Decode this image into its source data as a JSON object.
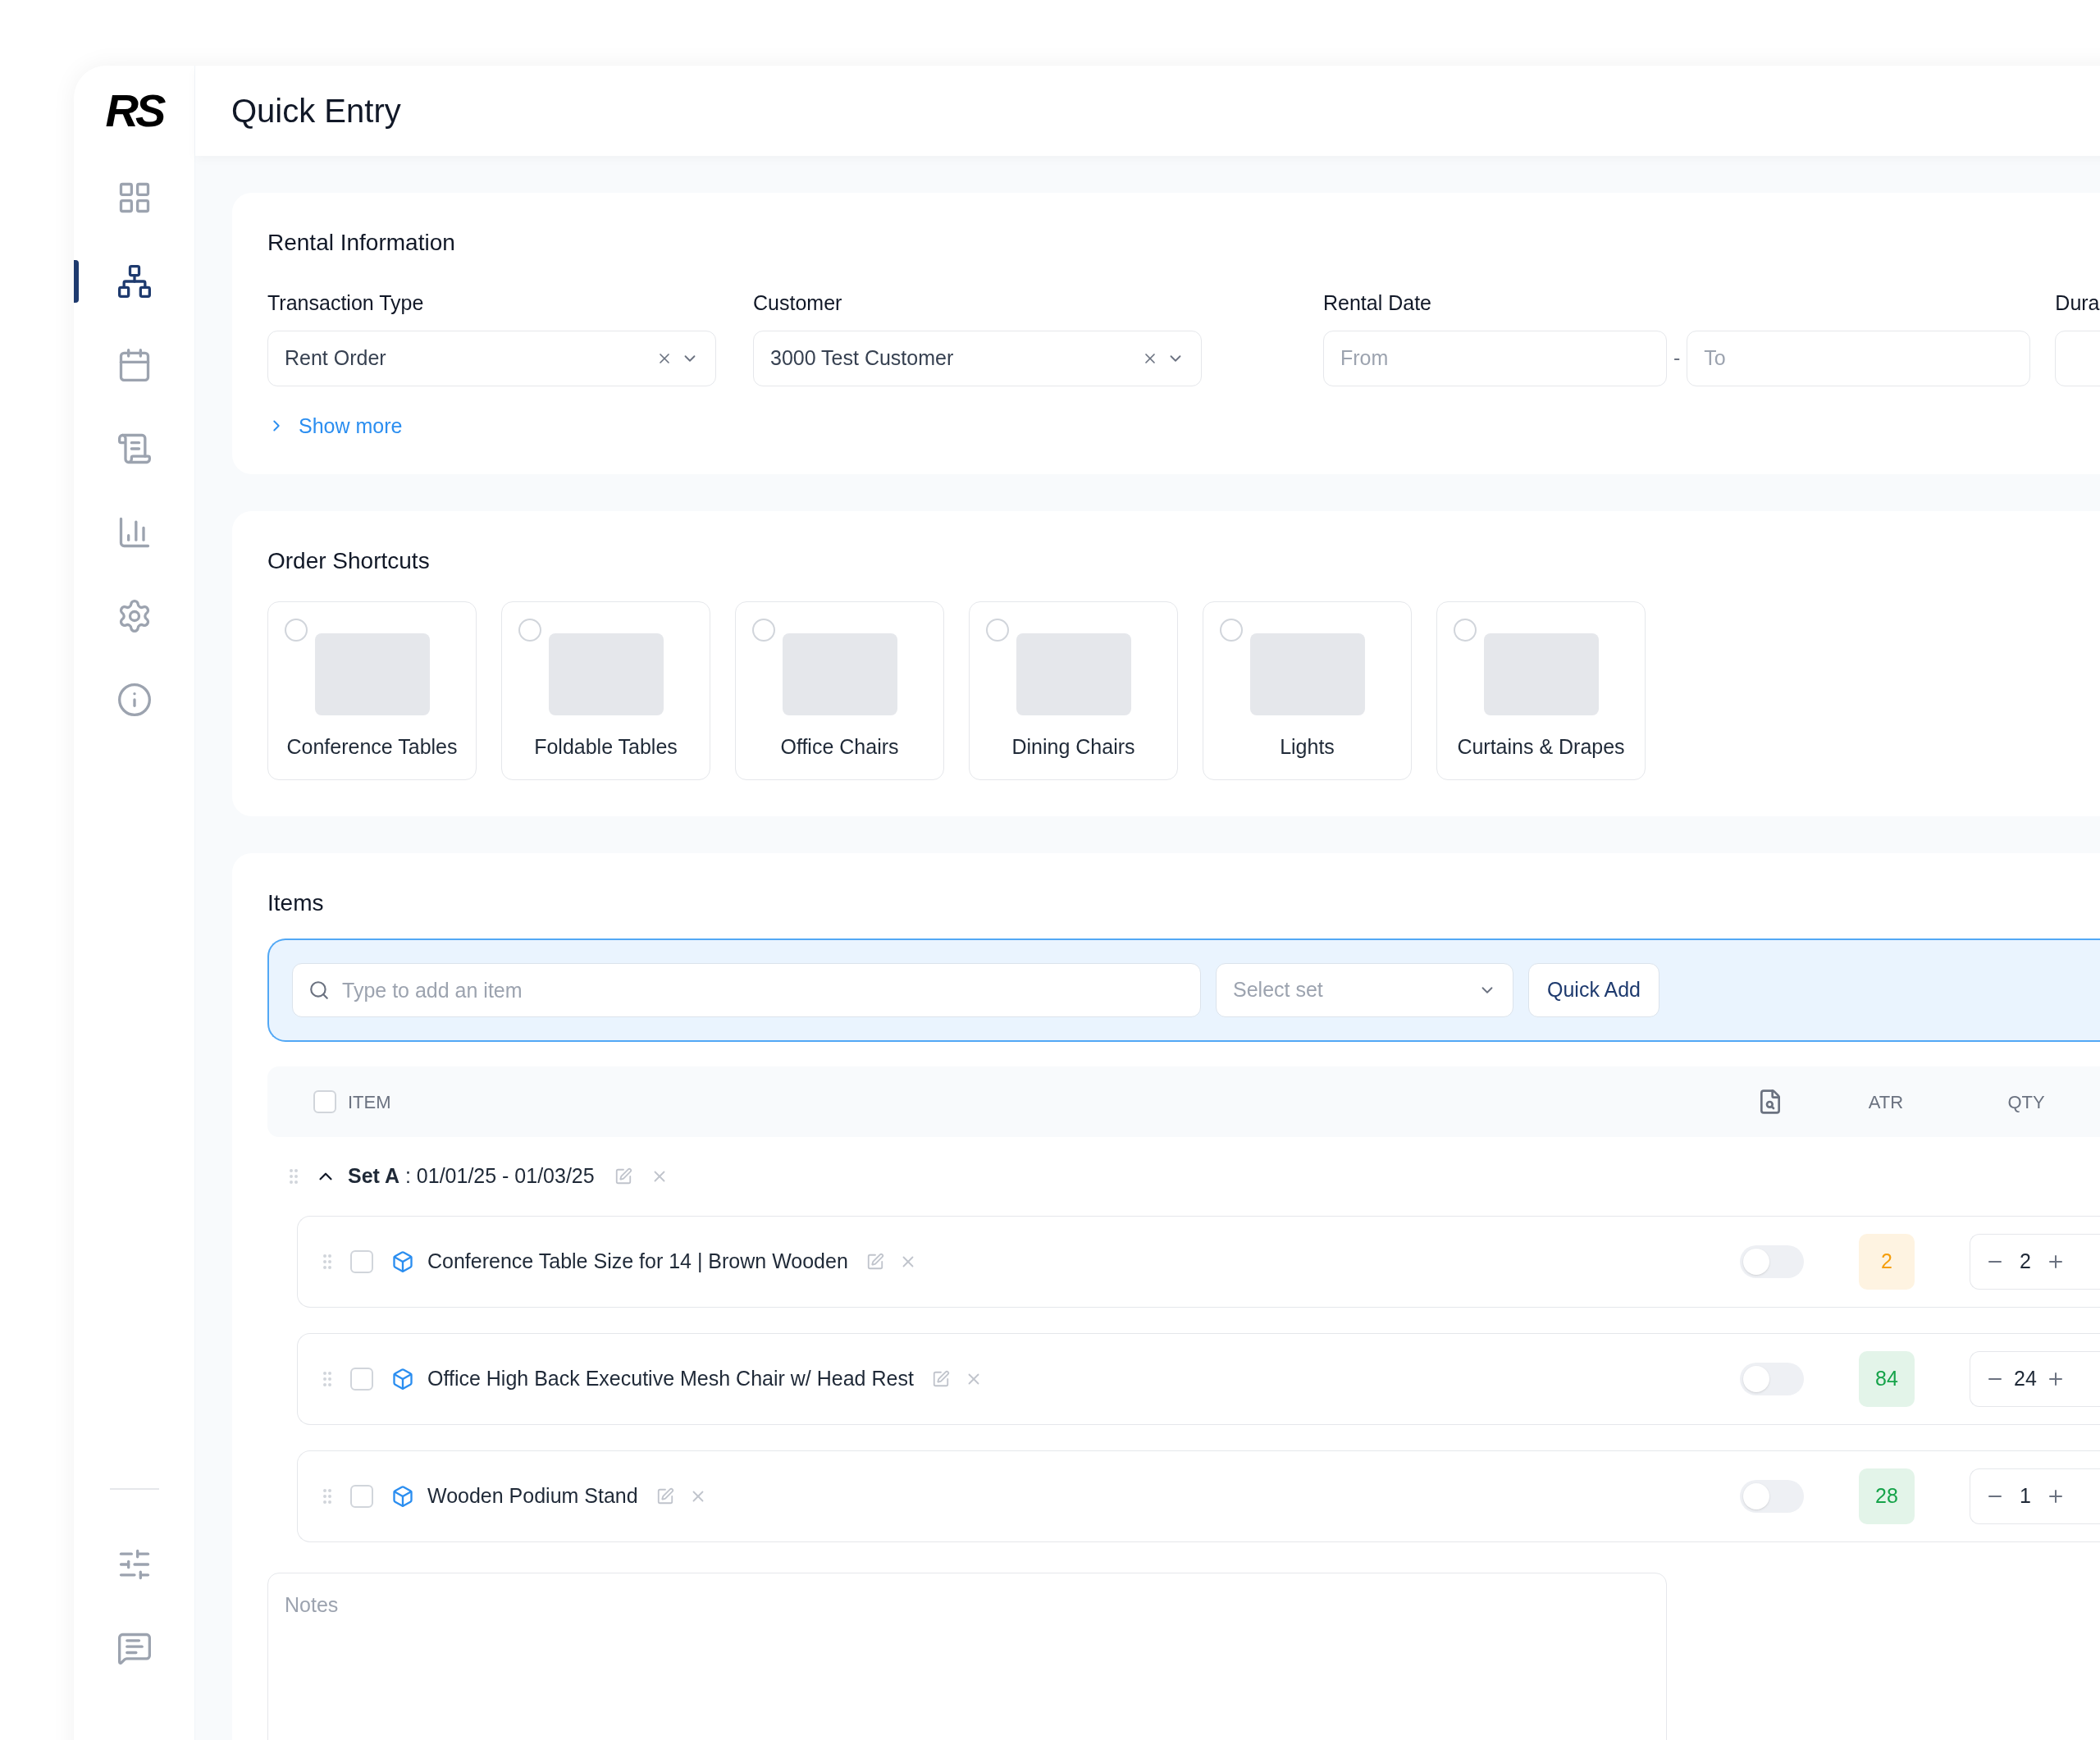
{
  "sidebar": {
    "logo": "RS",
    "items": [
      {
        "selected": false
      },
      {
        "selected": true
      },
      {
        "selected": false
      },
      {
        "selected": false
      },
      {
        "selected": false
      },
      {
        "selected": false
      },
      {
        "selected": false
      }
    ],
    "bottom_items": [
      {
        "selected": false
      },
      {
        "selected": false
      }
    ]
  },
  "header": {
    "title": "Quick Entry"
  },
  "rental_information": {
    "title": "Rental Information",
    "fields": [
      {
        "label": "Transaction Type",
        "value": "Rent Order"
      },
      {
        "label": "Customer",
        "value": "3000 Test Customer"
      }
    ],
    "rental_date": {
      "label": "Rental Date",
      "from_placeholder": "From",
      "separator": "-",
      "to_placeholder": "To"
    },
    "cut_label": "Dura",
    "show_more": "Show more"
  },
  "order_shortcuts": {
    "title": "Order Shortcuts",
    "items": [
      {
        "label": "Conference Tables",
        "selected": false
      },
      {
        "label": "Foldable Tables",
        "selected": false
      },
      {
        "label": "Office Chairs",
        "selected": false
      },
      {
        "label": "Dining Chairs",
        "selected": false
      },
      {
        "label": "Lights",
        "selected": false
      },
      {
        "label": "Curtains & Drapes",
        "selected": false
      }
    ]
  },
  "items": {
    "title": "Items",
    "search": {
      "placeholder": "Type to add an item"
    },
    "set_select": {
      "placeholder": "Select set"
    },
    "quick_add": "Quick Add",
    "columns": [
      {
        "label": "ITEM",
        "checked": false
      },
      {
        "label": "ATR"
      },
      {
        "label": "QTY"
      }
    ],
    "sets": [
      {
        "title": "**Set A** : 01/01/25 - 01/03/25",
        "expanded": true,
        "rows": [
          {
            "name": "Conference Table Size for 14 | Brown Wooden",
            "checked": false,
            "on": false,
            "atr": "2",
            "color": "#f59e0b",
            "qty": "2"
          },
          {
            "name": "Office High Back Executive Mesh Chair w/ Head Rest",
            "checked": false,
            "on": false,
            "atr": "84",
            "color": "#16a34a",
            "qty": "24"
          },
          {
            "name": "Wooden Podium Stand",
            "checked": false,
            "on": false,
            "atr": "28",
            "color": "#16a34a",
            "qty": "1"
          }
        ]
      }
    ],
    "notes": {
      "placeholder": "Notes"
    }
  }
}
